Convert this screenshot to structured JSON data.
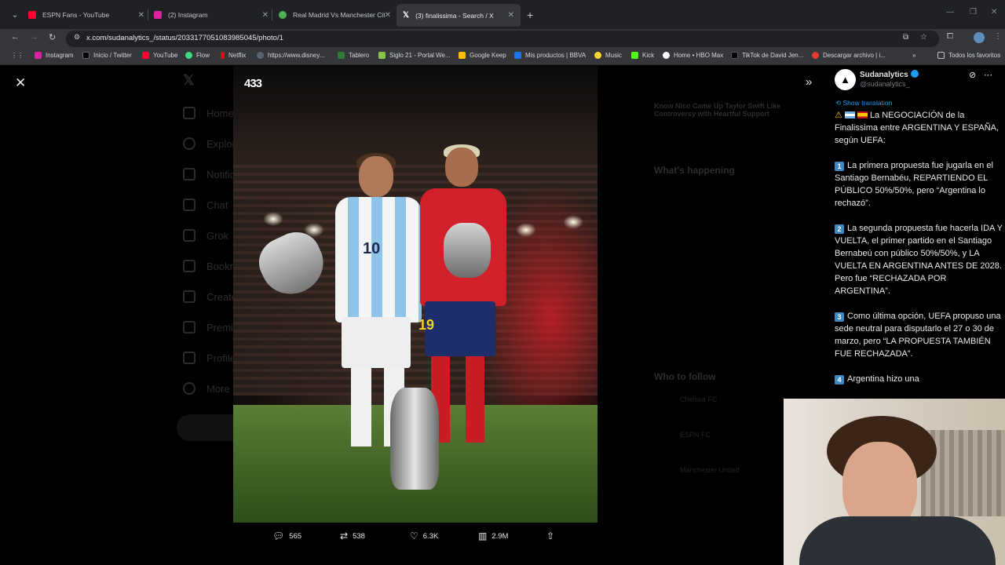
{
  "browser": {
    "tabs": [
      {
        "title": "ESPN Fans - YouTube",
        "favicon_color": "#ff0033"
      },
      {
        "title": "(2) Instagram",
        "favicon_color": "#d6249f"
      },
      {
        "title": "Real Madrid Vs Manchester City",
        "favicon_color": "#4caf50"
      },
      {
        "title": "(3) finalissima - Search / X",
        "favicon_color": "#000000",
        "active": true
      }
    ],
    "url": "x.com/sudanalytics_/status/2033177051083985045/photo/1",
    "bookmarks": [
      {
        "label": "Instagram",
        "color": "#d6249f"
      },
      {
        "label": "Inicio / Twitter",
        "color": "#000000"
      },
      {
        "label": "YouTube",
        "color": "#ff0033"
      },
      {
        "label": "Flow",
        "color": "#3ddc84"
      },
      {
        "label": "Netflix",
        "color": "#e50914"
      },
      {
        "label": "https://www.disney...",
        "color": "#5a6474"
      },
      {
        "label": "Tablero",
        "color": "#2f7d32"
      },
      {
        "label": "Siglo 21 - Portal We...",
        "color": "#8bc34a"
      },
      {
        "label": "Google Keep",
        "color": "#fbbc04"
      },
      {
        "label": "Mis productos | BBVA",
        "color": "#1a73e8"
      },
      {
        "label": "Music",
        "color": "#fdd835"
      },
      {
        "label": "Kick",
        "color": "#53fc18"
      },
      {
        "label": "Home • HBO Max",
        "color": "#ffffff"
      },
      {
        "label": "TikTok de David Jen...",
        "color": "#000000"
      },
      {
        "label": "Descargar archivo | i...",
        "color": "#e53935"
      }
    ],
    "all_bookmarks": "Todos los favoritos"
  },
  "photo": {
    "logo": "433",
    "shirt_number_left": "10",
    "shirt_number_right": "19"
  },
  "actions": {
    "replies": "565",
    "reposts": "538",
    "likes": "6.3K",
    "views": "2.9M"
  },
  "tweet": {
    "name": "Sudanalytics",
    "handle": "@sudanalytics_",
    "show_translation": "Show translation",
    "intro": "La NEGOCIACIÓN de la Finalissima entre ARGENTINA Y ESPAÑA, según UEFA:",
    "points": [
      {
        "num": "1",
        "text": "La primera propuesta fue jugarla en el Santiago Bernabéu, REPARTIENDO EL PÚBLICO 50%/50%, pero “Argentina lo rechazó”."
      },
      {
        "num": "2",
        "text": "La segunda propuesta fue hacerla IDA Y VUELTA, el primer partido en el Santiago Bernabeú con público 50%/50%, y LA VUELTA EN ARGENTINA ANTES DE 2028. Pero fue “RECHAZADA POR ARGENTINA”."
      },
      {
        "num": "3",
        "text": "Como última opción, UEFA propuso una sede neutral para disputarlo el 27 o 30 de marzo, pero “LA PROPUESTA TAMBIÉN FUE RECHAZADA”."
      },
      {
        "num": "4",
        "text": "Argentina hizo una"
      }
    ]
  },
  "background_dim": {
    "nav": [
      "Home",
      "Explore",
      "Notifications",
      "Chat",
      "Grok",
      "Bookmarks",
      "Creator Studio",
      "Premium",
      "Profile",
      "More"
    ],
    "trend_snippet": "Know Nico Came Up Taylor Swift Like Controversy with Heartful Support",
    "whats_happening": "What's happening",
    "who_to_follow": "Who to follow",
    "follow_items": [
      "Chelsea FC",
      "ESPN FC",
      "Manchester United"
    ]
  }
}
